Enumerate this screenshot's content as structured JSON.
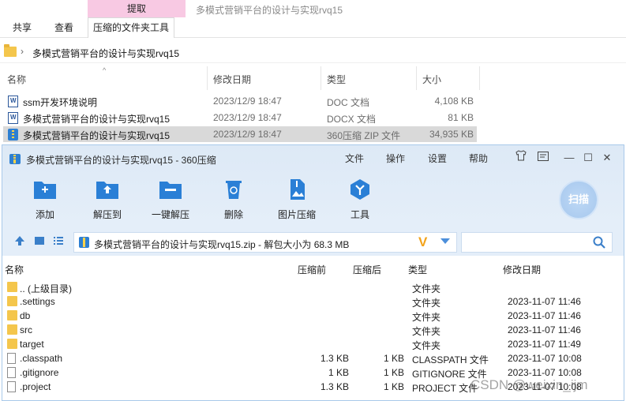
{
  "explorer": {
    "ribbon": {
      "context_tab_header": "提取",
      "window_title": "多模式营销平台的设计与实现rvq15",
      "tabs": [
        "共享",
        "查看",
        "压缩的文件夹工具"
      ]
    },
    "address": {
      "path": "多模式营销平台的设计与实现rvq15"
    },
    "columns": {
      "name": "名称",
      "date": "修改日期",
      "type": "类型",
      "size": "大小"
    },
    "files": [
      {
        "name": "ssm开发环境说明",
        "date": "2023/12/9 18:47",
        "type": "DOC 文档",
        "size": "4,108 KB"
      },
      {
        "name": "多模式营销平台的设计与实现rvq15",
        "date": "2023/12/9 18:47",
        "type": "DOCX 文档",
        "size": "81 KB"
      },
      {
        "name": "多模式营销平台的设计与实现rvq15",
        "date": "2023/12/9 18:47",
        "type": "360压缩 ZIP 文件",
        "size": "34,935 KB"
      }
    ]
  },
  "zip360": {
    "title": "多模式营销平台的设计与实现rvq15 - 360压缩",
    "menu": [
      "文件",
      "操作",
      "设置",
      "帮助"
    ],
    "tools": [
      "添加",
      "解压到",
      "一键解压",
      "删除",
      "图片压缩",
      "工具"
    ],
    "scan_label": "扫描",
    "path_text": "多模式营销平台的设计与实现rvq15.zip - 解包大小为 68.3 MB",
    "columns": {
      "name": "名称",
      "size": "压缩前",
      "packed": "压缩后",
      "type": "类型",
      "date": "修改日期"
    },
    "rows": [
      {
        "name": ".. (上级目录)",
        "size": "",
        "packed": "",
        "type": "文件夹",
        "date": "",
        "kind": "folder"
      },
      {
        "name": ".settings",
        "size": "",
        "packed": "",
        "type": "文件夹",
        "date": "2023-11-07 11:46",
        "kind": "folder"
      },
      {
        "name": "db",
        "size": "",
        "packed": "",
        "type": "文件夹",
        "date": "2023-11-07 11:46",
        "kind": "folder"
      },
      {
        "name": "src",
        "size": "",
        "packed": "",
        "type": "文件夹",
        "date": "2023-11-07 11:46",
        "kind": "folder"
      },
      {
        "name": "target",
        "size": "",
        "packed": "",
        "type": "文件夹",
        "date": "2023-11-07 11:49",
        "kind": "folder"
      },
      {
        "name": ".classpath",
        "size": "1.3 KB",
        "packed": "1 KB",
        "type": "CLASSPATH 文件",
        "date": "2023-11-07 10:08",
        "kind": "file"
      },
      {
        "name": ".gitignore",
        "size": "1 KB",
        "packed": "1 KB",
        "type": "GITIGNORE 文件",
        "date": "2023-11-07 10:08",
        "kind": "file"
      },
      {
        "name": ".project",
        "size": "1.3 KB",
        "packed": "1 KB",
        "type": "PROJECT 文件",
        "date": "2023-11-07 10:08",
        "kind": "file"
      }
    ]
  },
  "watermark": "CSDN @weixin_ijm"
}
